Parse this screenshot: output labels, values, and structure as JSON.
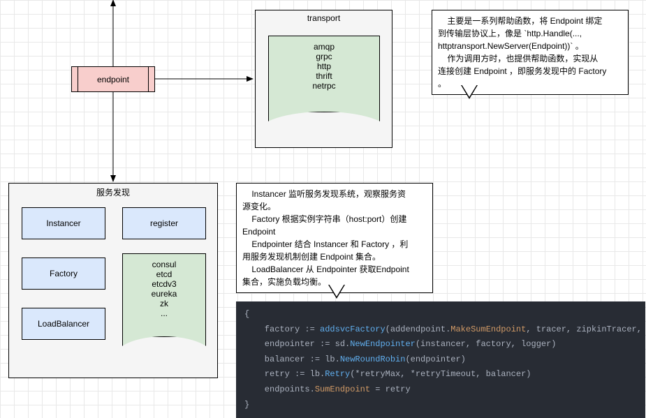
{
  "endpoint": {
    "label": "endpoint"
  },
  "transport": {
    "title": "transport",
    "items": [
      "amqp",
      "grpc",
      "http",
      "thrift",
      "netrpc"
    ]
  },
  "callout1": {
    "line1_indent": "主要是一系列帮助函数，将 Endpoint 绑定",
    "line2": "到传输层协议上，像是 `http.Handle(...,",
    "line3": "httptransport.NewServer(Endpoint))` 。",
    "line4_indent": "作为调用方时，也提供帮助函数，实现从",
    "line5": "连接创建 Endpoint ，即服务发现中的 Factory",
    "line6": "。"
  },
  "discovery": {
    "title": "服务发现",
    "instancer": "Instancer",
    "factory": "Factory",
    "loadbalancer": "LoadBalancer",
    "register": "register",
    "impl_items": [
      "consul",
      "etcd",
      "etcdv3",
      "eureka",
      "zk",
      "..."
    ]
  },
  "callout2": {
    "line1_indent": "Instancer 监听服务发现系统，观察服务资",
    "line2": "源变化。",
    "line3_indent": "Factory 根据实例字符串（host:port）创建",
    "line4": "Endpoint",
    "line5_indent": "Endpointer 结合 Instancer 和 Factory ，利",
    "line6": "用服务发现机制创建 Endpoint 集合。",
    "line7_indent": "LoadBalancer 从 Endpointer 获取Endpoint",
    "line8": "集合，实施负载均衡。"
  },
  "code": {
    "open": "{",
    "l1_prefix": "    factory := ",
    "l1_fn": "addsvcFactory",
    "l1_p1": "(addendpoint.",
    "l1_attr": "MakeSumEndpoint",
    "l1_p2": ", tracer, zipkinTracer, logger)",
    "l2_prefix": "    endpointer := sd.",
    "l2_fn": "NewEndpointer",
    "l2_p": "(instancer, factory, logger)",
    "l3_prefix": "    balancer := lb.",
    "l3_fn": "NewRoundRobin",
    "l3_p": "(endpointer)",
    "l4_prefix": "    retry := lb.",
    "l4_fn": "Retry",
    "l4_p": "(*retryMax, *retryTimeout, balancer)",
    "l5_prefix": "    endpoints.",
    "l5_attr": "SumEndpoint",
    "l5_p": " = retry",
    "close": "}"
  }
}
